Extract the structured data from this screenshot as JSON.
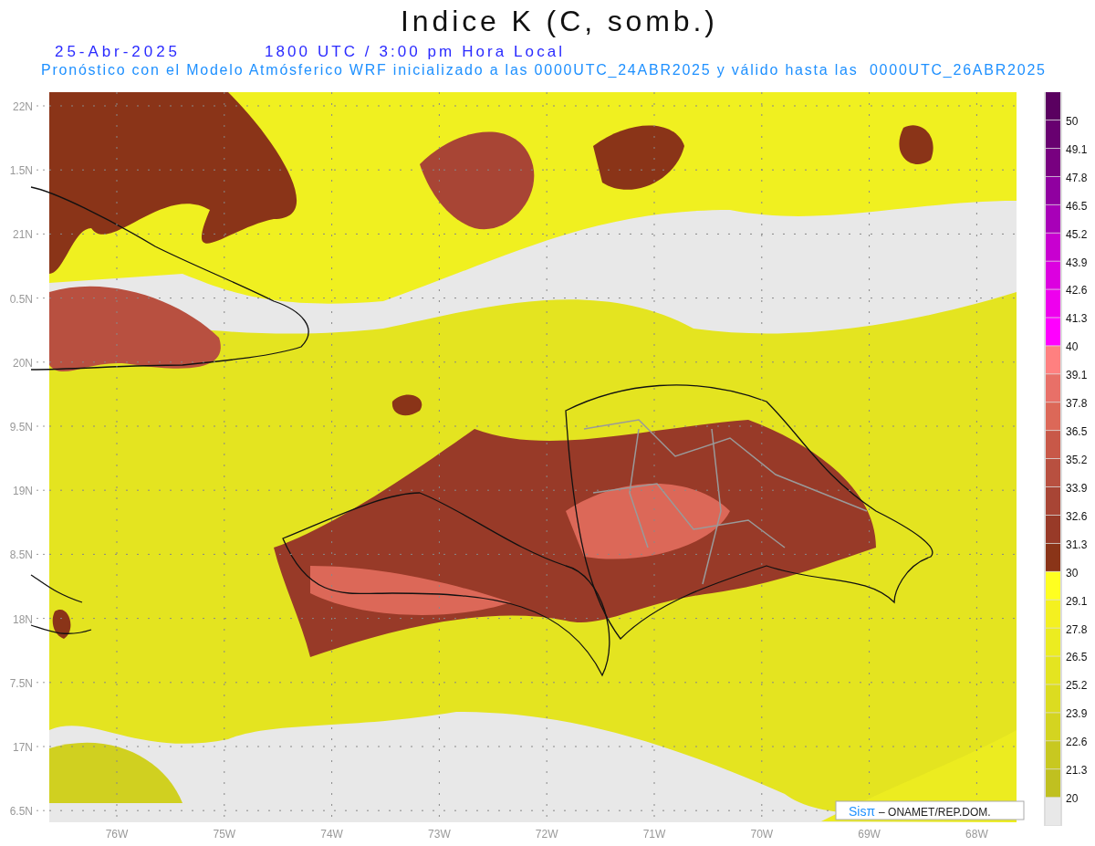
{
  "title": "Indice K (C, somb.)",
  "date": "25-Abr-2025",
  "time": "1800 UTC / 3:00 pm Hora Local",
  "subtitle": "Pronóstico con el Modelo Atmósferico WRF inicializado a las 0000UTC_24ABR2025 y válido hasta las  0000UTC_26ABR2025",
  "y_labels": [
    "22N",
    "1.5N",
    "21N",
    "0.5N",
    "20N",
    "9.5N",
    "19N",
    "8.5N",
    "18N",
    "7.5N",
    "17N",
    "6.5N"
  ],
  "x_labels": [
    "76W",
    "75W",
    "74W",
    "73W",
    "72W",
    "71W",
    "70W",
    "69W",
    "68W"
  ],
  "credit": {
    "brand": "Sisπ",
    "text": "– ONAMET/REP.DOM."
  },
  "colorbar": {
    "boxes": [
      {
        "color": "#5a0060"
      },
      {
        "color": "#680070"
      },
      {
        "color": "#780080"
      },
      {
        "color": "#9000a0"
      },
      {
        "color": "#a800b8"
      },
      {
        "color": "#c800d0"
      },
      {
        "color": "#dc00e0"
      },
      {
        "color": "#ee00ee"
      },
      {
        "color": "#ff00ff"
      },
      {
        "color": "#ff8080"
      },
      {
        "color": "#e87068"
      },
      {
        "color": "#dc6858"
      },
      {
        "color": "#c85848"
      },
      {
        "color": "#b85040"
      },
      {
        "color": "#a84535"
      },
      {
        "color": "#983a28"
      },
      {
        "color": "#8a3418"
      },
      {
        "color": "#ffff20"
      },
      {
        "color": "#f4f020"
      },
      {
        "color": "#ecec20"
      },
      {
        "color": "#e4e420"
      },
      {
        "color": "#dcdc20"
      },
      {
        "color": "#d4d420"
      },
      {
        "color": "#c8c820"
      },
      {
        "color": "#c0c020"
      },
      {
        "color": "#e8e8e8"
      }
    ],
    "labels": [
      "50",
      "49.1",
      "47.8",
      "46.5",
      "45.2",
      "43.9",
      "42.6",
      "41.3",
      "40",
      "39.1",
      "37.8",
      "36.5",
      "35.2",
      "33.9",
      "32.6",
      "31.3",
      "30",
      "29.1",
      "27.8",
      "26.5",
      "25.2",
      "23.9",
      "22.6",
      "21.3",
      "20"
    ]
  }
}
